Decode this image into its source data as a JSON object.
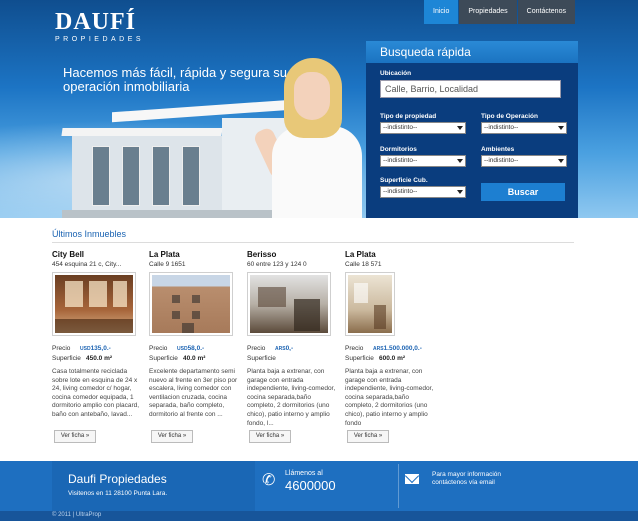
{
  "brand": {
    "logo": "DAUFÍ",
    "logo_sub": "PROPIEDADES"
  },
  "nav": [
    {
      "label": "Inicio",
      "active": true
    },
    {
      "label": "Propiedades",
      "active": false
    },
    {
      "label": "Contáctenos",
      "active": false
    }
  ],
  "hero": {
    "tagline": "Hacemos más fácil, rápida y segura su operación inmobiliaria"
  },
  "search": {
    "title": "Busqueda rápida",
    "location_label": "Ubicación",
    "location_placeholder": "Calle, Barrio, Localidad",
    "tipo_propiedad_label": "Tipo de propiedad",
    "tipo_propiedad_value": "--indistinto--",
    "tipo_operacion_label": "Tipo de Operación",
    "tipo_operacion_value": "--indistinto--",
    "dormitorios_label": "Dormitorios",
    "dormitorios_value": "--indistinto--",
    "ambientes_label": "Ambientes",
    "ambientes_value": "--indistinto--",
    "superficie_label": "Superficie Cub.",
    "superficie_value": "--indistinto--",
    "button": "Buscar"
  },
  "listings": {
    "title": "Últimos Inmuebles",
    "price_label": "Precio",
    "surface_label": "Superficie",
    "button_label": "Ver ficha »",
    "items": [
      {
        "city": "City Bell",
        "address": "454 esquina 21 c, City...",
        "currency": "USD",
        "price": "135,0.-",
        "surface": "450.0 m²",
        "desc": "Casa totalmente reciclada sobre lote en esquina de 24 x 24, living comedor c/ hogar, cocina comedor equipada, 1 dormitorio amplio con placard, baño con antebaño, lavad..."
      },
      {
        "city": "La Plata",
        "address": "Calle 9 1651",
        "currency": "USD",
        "price": "58,0.-",
        "surface": "40.0 m²",
        "desc": "Excelente departamento semi nuevo al frente en 3er piso por escalera, living comedor con ventilacion cruzada, cocina separada, baño completo, dormitorio al frente con ..."
      },
      {
        "city": "Berisso",
        "address": "60 entre 123 y 124 0",
        "currency": "ARS",
        "price": "0,-",
        "surface": "",
        "desc": "Planta baja a extrenar, con garage con entrada independiente, living-comedor, cocina separada,baño completo, 2 dormitorios (uno chico), patio interno y amplio fondo, l..."
      },
      {
        "city": "La Plata",
        "address": "Calle 18 571",
        "currency": "ARS",
        "price": "1.500.000,0.-",
        "surface": "600.0 m²",
        "desc": "Planta baja a extrenar, con garage con entrada independiente, living-comedor, cocina separada,baño completo, 2 dormitorios (uno chico), patio interno y amplio fondo"
      }
    ]
  },
  "footer": {
    "brand": "Daufi Propiedades",
    "address": "Visitenos en 11 28100 Punta Lara.",
    "call_label": "Llámenos al",
    "phone": "4600000",
    "info": "Para mayor información contáctenos vía email",
    "copyright": "© 2011 | UltraProp"
  }
}
